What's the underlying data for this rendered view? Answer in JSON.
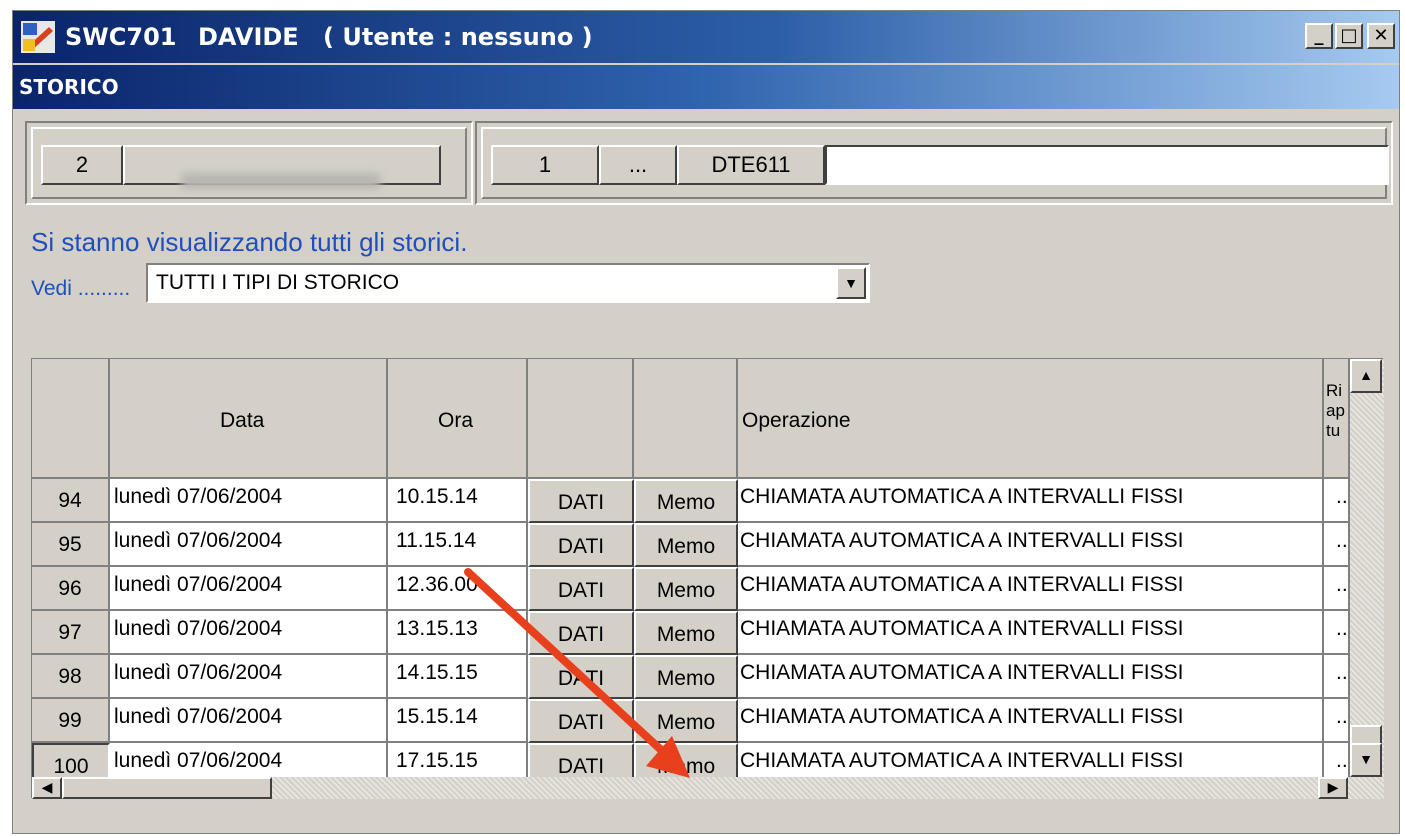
{
  "window": {
    "app": "SWC701",
    "name": "DAVIDE",
    "user": "( Utente : nessuno )",
    "buttons": {
      "minimize": "_",
      "maximize": "□",
      "close": "✕"
    }
  },
  "subtitle": "STORICO",
  "top_panel": {
    "left_number": "2",
    "right_number": "1",
    "ellipsis": "...",
    "code": "DTE611",
    "code_value": ""
  },
  "info_text": "Si stanno visualizzando tutti gli storici.",
  "filter": {
    "label": "Vedi .........",
    "selected": "TUTTI I TIPI DI STORICO"
  },
  "grid": {
    "headers": {
      "number": "",
      "date": "Data",
      "time": "Ora",
      "dati": "",
      "memo": "",
      "operation": "Operazione",
      "last": "Ri ap tu"
    },
    "rows": [
      {
        "n": "94",
        "date": "lunedì  07/06/2004",
        "time": "10.15.14",
        "dati": "DATI",
        "memo": "Memo",
        "operation": "CHIAMATA AUTOMATICA A INTERVALLI FISSI",
        "last": "..."
      },
      {
        "n": "95",
        "date": "lunedì  07/06/2004",
        "time": "11.15.14",
        "dati": "DATI",
        "memo": "Memo",
        "operation": "CHIAMATA AUTOMATICA A INTERVALLI FISSI",
        "last": "..."
      },
      {
        "n": "96",
        "date": "lunedì  07/06/2004",
        "time": "12.36.00",
        "dati": "DATI",
        "memo": "Memo",
        "operation": "CHIAMATA AUTOMATICA A INTERVALLI FISSI",
        "last": "..."
      },
      {
        "n": "97",
        "date": "lunedì  07/06/2004",
        "time": "13.15.13",
        "dati": "DATI",
        "memo": "Memo",
        "operation": "CHIAMATA AUTOMATICA A INTERVALLI FISSI",
        "last": "..."
      },
      {
        "n": "98",
        "date": "lunedì  07/06/2004",
        "time": "14.15.15",
        "dati": "DATI",
        "memo": "Memo",
        "operation": "CHIAMATA AUTOMATICA A INTERVALLI FISSI",
        "last": "..."
      },
      {
        "n": "99",
        "date": "lunedì  07/06/2004",
        "time": "15.15.14",
        "dati": "DATI",
        "memo": "Memo",
        "operation": "CHIAMATA AUTOMATICA A INTERVALLI FISSI",
        "last": "..."
      },
      {
        "n": "100",
        "date": "lunedì  07/06/2004",
        "time": "17.15.15",
        "dati": "DATI",
        "memo": "Memo",
        "operation": "CHIAMATA AUTOMATICA A INTERVALLI FISSI",
        "last": "..."
      }
    ]
  },
  "colors": {
    "title_dark": "#0a246a",
    "title_light": "#a6caf0",
    "info_blue": "#1f4fbf",
    "annotation_arrow": "#e8401c"
  },
  "annotation": "arrow-pointing-to-memo-button"
}
